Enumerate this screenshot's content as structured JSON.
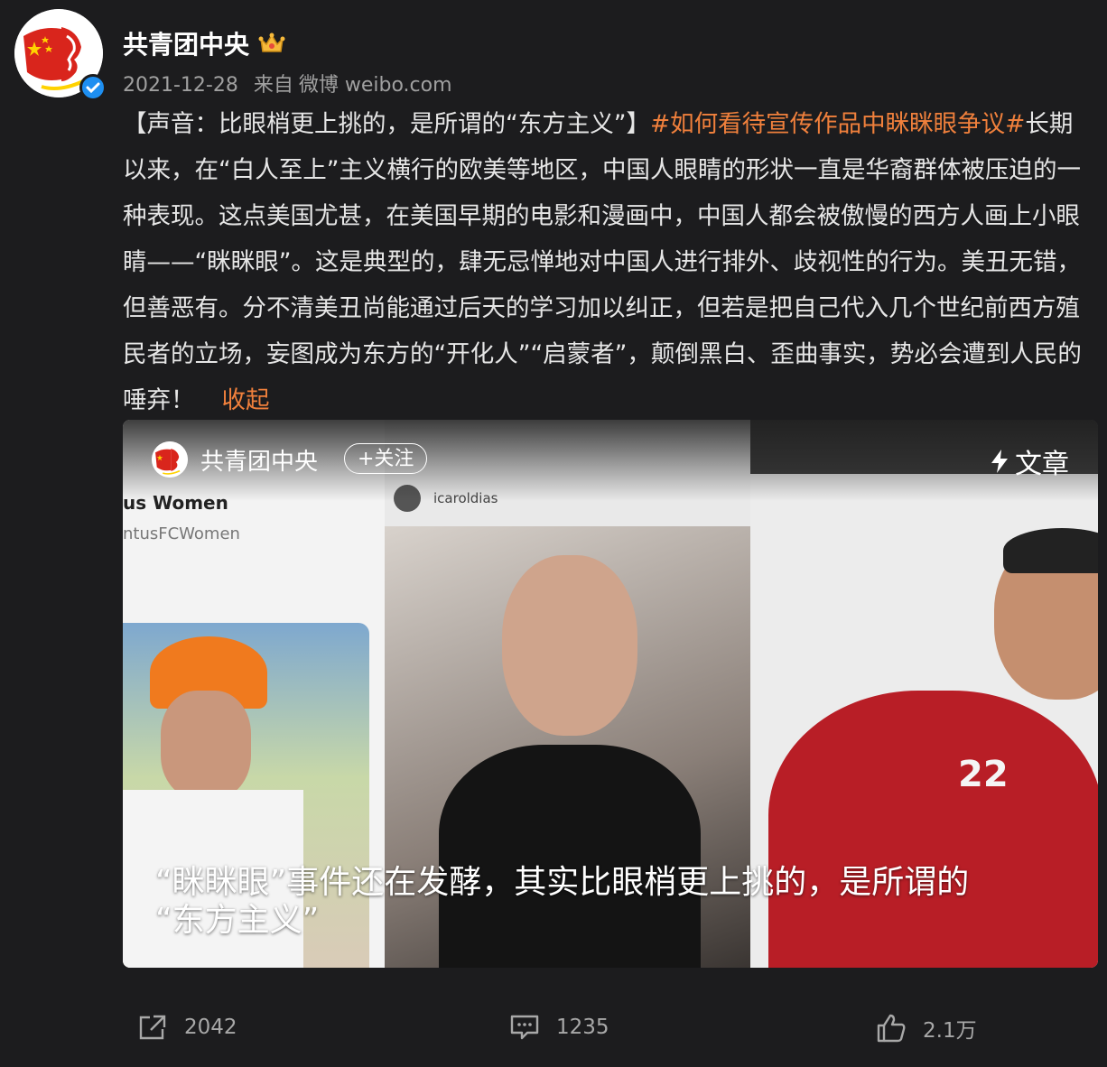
{
  "post": {
    "author": "共青团中央",
    "date": "2021-12-28",
    "source_prefix": "来自",
    "source": "微博 weibo.com",
    "text_before": "【声音：比眼梢更上挑的，是所谓的“东方主义”】",
    "hashtag": "#如何看待宣传作品中眯眯眼争议#",
    "text_after": "长期以来，在“白人至上”主义横行的欧美等地区，中国人眼睛的形状一直是华裔群体被压迫的一种表现。这点美国尤甚，在美国早期的电影和漫画中，中国人都会被傲慢的西方人画上小眼睛——“眯眯眼”。这是典型的，肆无忌惮地对中国人进行排外、歧视性的行为。美丑无错，但善恶有。分不清美丑尚能通过后天的学习加以纠正，但若是把自己代入几个世纪前西方殖民者的立场，妄图成为东方的“开化人”“启蒙者”，颠倒黑白、歪曲事实，势必会遭到人民的唾弃！",
    "collapse_label": "收起"
  },
  "card": {
    "author": "共青团中央",
    "follow_label": "+关注",
    "article_label": "文章",
    "title_line1": "“眯眯眼”事件还在发酵，其实比眼梢更上挑的，是所谓的",
    "title_line2": "“东方主义”",
    "image_text": {
      "left_handle": "us Women",
      "left_sub": "ntusFCWomen",
      "middle_handle": "icaroldias",
      "jersey_number": "22"
    }
  },
  "actions": {
    "share_count": "2042",
    "comment_count": "1235",
    "like_count": "2.1万"
  },
  "colors": {
    "background": "#1c1c1e",
    "accent": "#f0803c",
    "verified": "#1e8ff1",
    "text": "#e6e6e6",
    "muted": "#a0a0a0"
  },
  "icons": [
    "avatar-logo",
    "verified-icon",
    "crown-icon",
    "lightning-icon",
    "share-icon",
    "comment-icon",
    "like-icon"
  ]
}
